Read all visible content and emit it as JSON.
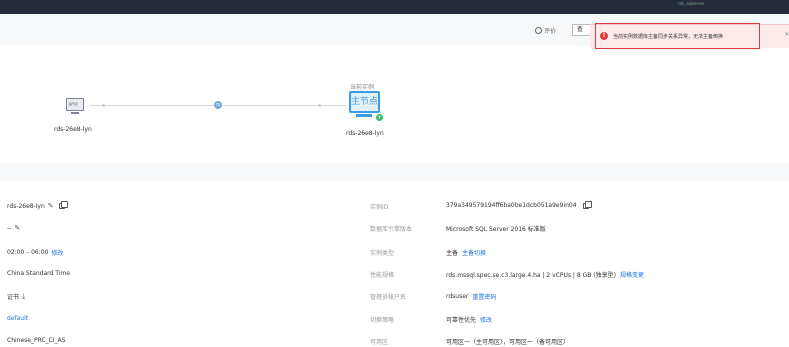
{
  "topbar": {
    "faint_text": "rds_sqlserver"
  },
  "toolbar": {
    "evaluate_label": "评价",
    "view_button": "查"
  },
  "alert": {
    "message": "当前实例数据库主备同步关系异常，无法主备倒换",
    "close": "×"
  },
  "topology": {
    "standby": {
      "icon_text": "备节点",
      "label": "rds-26e8-lyn"
    },
    "current_instance_label": "当前实例",
    "primary": {
      "icon_text": "主节点",
      "label": "rds-26e8-lyn"
    }
  },
  "details": {
    "left": [
      {
        "value": "rds-26e8-lyn"
      },
      {
        "value": "--"
      },
      {
        "value": "02:00 – 06:00",
        "action": "修改"
      },
      {
        "value": "China Standard Time"
      },
      {
        "value": "证书"
      },
      {
        "value": "default"
      },
      {
        "value": "Chinese_PRC_CI_AS"
      }
    ],
    "right": [
      {
        "key": "实例ID",
        "value": "379a349579194ff6ba0be1dcb051a9e9in04"
      },
      {
        "key": "数据库引擎版本",
        "value": "Microsoft SQL Server 2016 标准版"
      },
      {
        "key": "实例类型",
        "value": "主备",
        "action": "主备切换"
      },
      {
        "key": "性能规格",
        "value": "rds.mssql.spec.se.c3.large.4.ha | 2 vCPUs | 8 GB (独享型)",
        "action": "规格变更"
      },
      {
        "key": "管理员帐户名",
        "value": "rdsuser",
        "action": "重置密码"
      },
      {
        "key": "切换策略",
        "value": "可靠性优先",
        "action": "修改"
      },
      {
        "key": "可用区",
        "value": "可用区一（主可用区），可用区一（备可用区）"
      }
    ]
  },
  "colors": {
    "accent": "#1a73e8",
    "error": "#e0393e",
    "primary_node": "#3b9be5",
    "ok_badge": "#2fbf71"
  },
  "icons": [
    "smile-icon",
    "error-icon",
    "close-icon",
    "sync-icon",
    "edit-icon",
    "copy-icon",
    "download-icon"
  ]
}
